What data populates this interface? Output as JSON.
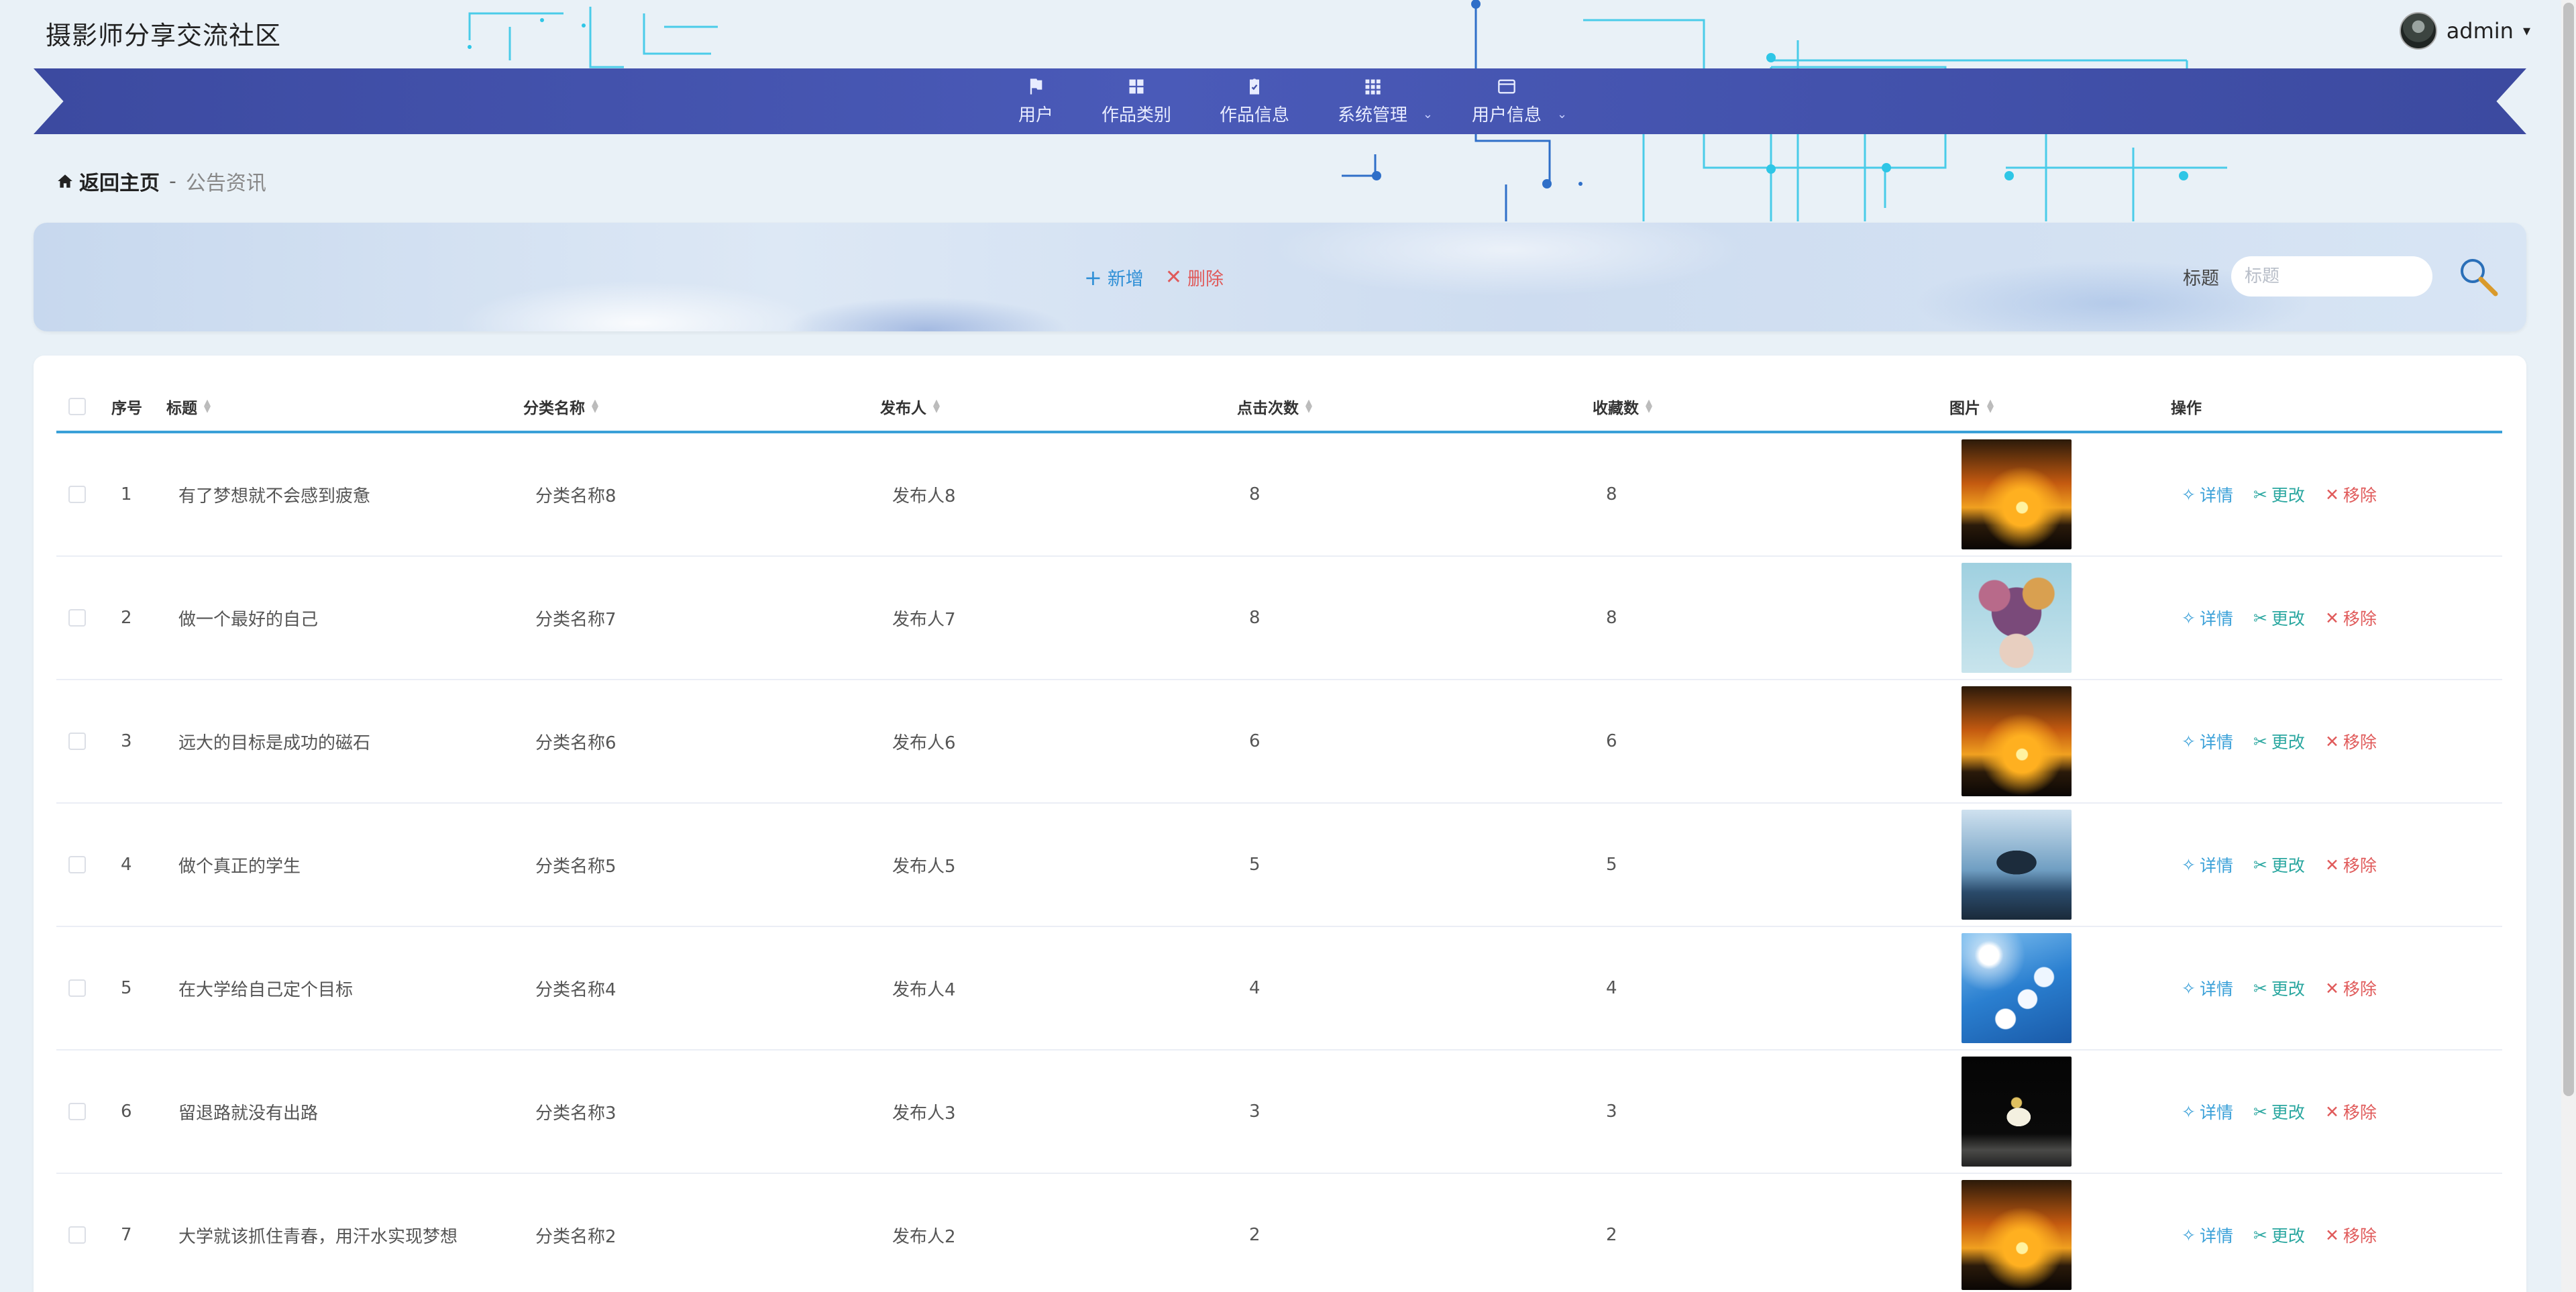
{
  "header": {
    "site_title": "摄影师分享交流社区",
    "username": "admin"
  },
  "nav": {
    "items": [
      {
        "label": "用户",
        "icon": "flag-icon"
      },
      {
        "label": "作品类别",
        "icon": "grid-icon"
      },
      {
        "label": "作品信息",
        "icon": "clipboard-check-icon"
      },
      {
        "label": "系统管理",
        "icon": "apps-icon",
        "submenu": true
      },
      {
        "label": "用户信息",
        "icon": "card-icon",
        "submenu": true
      }
    ]
  },
  "breadcrumb": {
    "home": "返回主页",
    "separator": "-",
    "current": "公告资讯"
  },
  "toolbar": {
    "add_label": "新增",
    "delete_label": "删除",
    "search_label": "标题",
    "search_placeholder": "标题",
    "search_value": ""
  },
  "table": {
    "columns": {
      "index": "序号",
      "title": "标题",
      "category": "分类名称",
      "publisher": "发布人",
      "clicks": "点击次数",
      "favorites": "收藏数",
      "image": "图片",
      "actions": "操作"
    },
    "action_labels": {
      "detail": "详情",
      "edit": "更改",
      "remove": "移除"
    },
    "rows": [
      {
        "index": "1",
        "title": "有了梦想就不会感到疲惫",
        "category": "分类名称8",
        "publisher": "发布人8",
        "clicks": "8",
        "favorites": "8",
        "image": "sunset-silhouette"
      },
      {
        "index": "2",
        "title": "做一个最好的自己",
        "category": "分类名称7",
        "publisher": "发布人7",
        "clicks": "8",
        "favorites": "8",
        "image": "flower-crown-portrait"
      },
      {
        "index": "3",
        "title": "远大的目标是成功的磁石",
        "category": "分类名称6",
        "publisher": "发布人6",
        "clicks": "6",
        "favorites": "6",
        "image": "sunset-silhouette"
      },
      {
        "index": "4",
        "title": "做个真正的学生",
        "category": "分类名称5",
        "publisher": "发布人5",
        "clicks": "5",
        "favorites": "5",
        "image": "whale-ocean"
      },
      {
        "index": "5",
        "title": "在大学给自己定个目标",
        "category": "分类名称4",
        "publisher": "发布人4",
        "clicks": "4",
        "favorites": "4",
        "image": "white-blossoms-sky"
      },
      {
        "index": "6",
        "title": "留退路就没有出路",
        "category": "分类名称3",
        "publisher": "发布人3",
        "clicks": "3",
        "favorites": "3",
        "image": "bird-on-rock"
      },
      {
        "index": "7",
        "title": "大学就该抓住青春，用汗水实现梦想",
        "category": "分类名称2",
        "publisher": "发布人2",
        "clicks": "2",
        "favorites": "2",
        "image": "sunset-silhouette"
      }
    ]
  },
  "colors": {
    "nav_bg": "#4050a8",
    "accent_blue": "#3aa0d8",
    "accent_teal": "#2aa7a0",
    "danger_red": "#e05a5a"
  }
}
